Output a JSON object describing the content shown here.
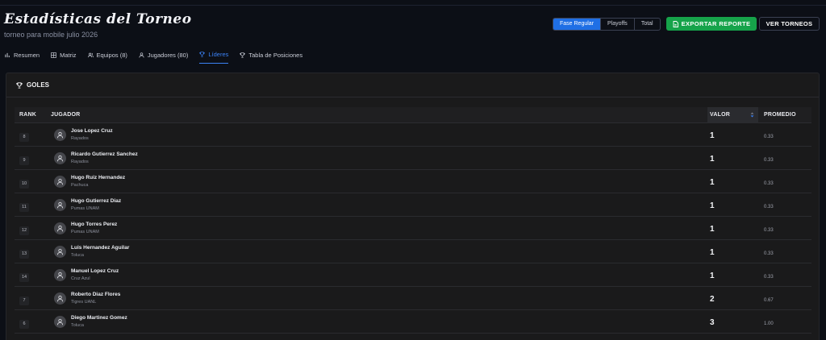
{
  "header": {
    "title": "Estadísticas del Torneo",
    "subtitle": "torneo para mobile julio 2026"
  },
  "phase_switch": {
    "options": [
      "Fase Regular",
      "Playoffs",
      "Total"
    ],
    "selected": "Fase Regular"
  },
  "actions": {
    "export_label": "EXPORTAR REPORTE",
    "view_label": "VER TORNEOS"
  },
  "tabs": [
    {
      "label": "Resumen",
      "icon": "bar-chart-icon"
    },
    {
      "label": "Matriz",
      "icon": "grid-icon"
    },
    {
      "label": "Equipos (8)",
      "icon": "users-icon"
    },
    {
      "label": "Jugadores (80)",
      "icon": "user-icon"
    },
    {
      "label": "Líderes",
      "icon": "trophy-icon",
      "active": true
    },
    {
      "label": "Tabla de Posiciones",
      "icon": "trophy-icon"
    }
  ],
  "panel": {
    "title": "GOLES",
    "columns": {
      "rank": "RANK",
      "player": "JUGADOR",
      "value": "VALOR",
      "average": "PROMEDIO"
    },
    "rows": [
      {
        "rank": "8",
        "name": "Jose Lopez Cruz",
        "team": "Rayados",
        "value": "1",
        "avg": "0.33"
      },
      {
        "rank": "9",
        "name": "Ricardo Gutierrez Sanchez",
        "team": "Rayados",
        "value": "1",
        "avg": "0.33"
      },
      {
        "rank": "10",
        "name": "Hugo Ruiz Hernandez",
        "team": "Pachuca",
        "value": "1",
        "avg": "0.33"
      },
      {
        "rank": "11",
        "name": "Hugo Gutierrez Diaz",
        "team": "Pumas UNAM",
        "value": "1",
        "avg": "0.33"
      },
      {
        "rank": "12",
        "name": "Hugo Torres Perez",
        "team": "Pumas UNAM",
        "value": "1",
        "avg": "0.33"
      },
      {
        "rank": "13",
        "name": "Luis Hernandez Aguilar",
        "team": "Toluca",
        "value": "1",
        "avg": "0.33"
      },
      {
        "rank": "14",
        "name": "Manuel Lopez Cruz",
        "team": "Cruz Azul",
        "value": "1",
        "avg": "0.33"
      },
      {
        "rank": "7",
        "name": "Roberto Diaz Flores",
        "team": "Tigres UANL",
        "value": "2",
        "avg": "0.67"
      },
      {
        "rank": "6",
        "name": "Diego Martinez Gomez",
        "team": "Toluca",
        "value": "3",
        "avg": "1.00"
      }
    ]
  },
  "colors": {
    "accent": "#1f6fe5",
    "export": "#16a34a",
    "background": "#0c0f16",
    "panel": "#1a1a1b"
  }
}
